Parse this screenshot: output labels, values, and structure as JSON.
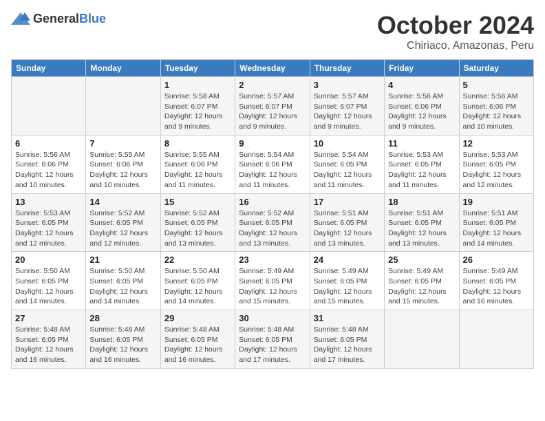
{
  "header": {
    "logo_general": "General",
    "logo_blue": "Blue",
    "month": "October 2024",
    "location": "Chiriaco, Amazonas, Peru"
  },
  "weekdays": [
    "Sunday",
    "Monday",
    "Tuesday",
    "Wednesday",
    "Thursday",
    "Friday",
    "Saturday"
  ],
  "weeks": [
    [
      {
        "day": "",
        "detail": ""
      },
      {
        "day": "",
        "detail": ""
      },
      {
        "day": "1",
        "detail": "Sunrise: 5:58 AM\nSunset: 6:07 PM\nDaylight: 12 hours and 9 minutes."
      },
      {
        "day": "2",
        "detail": "Sunrise: 5:57 AM\nSunset: 6:07 PM\nDaylight: 12 hours and 9 minutes."
      },
      {
        "day": "3",
        "detail": "Sunrise: 5:57 AM\nSunset: 6:07 PM\nDaylight: 12 hours and 9 minutes."
      },
      {
        "day": "4",
        "detail": "Sunrise: 5:56 AM\nSunset: 6:06 PM\nDaylight: 12 hours and 9 minutes."
      },
      {
        "day": "5",
        "detail": "Sunrise: 5:56 AM\nSunset: 6:06 PM\nDaylight: 12 hours and 10 minutes."
      }
    ],
    [
      {
        "day": "6",
        "detail": "Sunrise: 5:56 AM\nSunset: 6:06 PM\nDaylight: 12 hours and 10 minutes."
      },
      {
        "day": "7",
        "detail": "Sunrise: 5:55 AM\nSunset: 6:06 PM\nDaylight: 12 hours and 10 minutes."
      },
      {
        "day": "8",
        "detail": "Sunrise: 5:55 AM\nSunset: 6:06 PM\nDaylight: 12 hours and 11 minutes."
      },
      {
        "day": "9",
        "detail": "Sunrise: 5:54 AM\nSunset: 6:06 PM\nDaylight: 12 hours and 11 minutes."
      },
      {
        "day": "10",
        "detail": "Sunrise: 5:54 AM\nSunset: 6:05 PM\nDaylight: 12 hours and 11 minutes."
      },
      {
        "day": "11",
        "detail": "Sunrise: 5:53 AM\nSunset: 6:05 PM\nDaylight: 12 hours and 11 minutes."
      },
      {
        "day": "12",
        "detail": "Sunrise: 5:53 AM\nSunset: 6:05 PM\nDaylight: 12 hours and 12 minutes."
      }
    ],
    [
      {
        "day": "13",
        "detail": "Sunrise: 5:53 AM\nSunset: 6:05 PM\nDaylight: 12 hours and 12 minutes."
      },
      {
        "day": "14",
        "detail": "Sunrise: 5:52 AM\nSunset: 6:05 PM\nDaylight: 12 hours and 12 minutes."
      },
      {
        "day": "15",
        "detail": "Sunrise: 5:52 AM\nSunset: 6:05 PM\nDaylight: 12 hours and 13 minutes."
      },
      {
        "day": "16",
        "detail": "Sunrise: 5:52 AM\nSunset: 6:05 PM\nDaylight: 12 hours and 13 minutes."
      },
      {
        "day": "17",
        "detail": "Sunrise: 5:51 AM\nSunset: 6:05 PM\nDaylight: 12 hours and 13 minutes."
      },
      {
        "day": "18",
        "detail": "Sunrise: 5:51 AM\nSunset: 6:05 PM\nDaylight: 12 hours and 13 minutes."
      },
      {
        "day": "19",
        "detail": "Sunrise: 5:51 AM\nSunset: 6:05 PM\nDaylight: 12 hours and 14 minutes."
      }
    ],
    [
      {
        "day": "20",
        "detail": "Sunrise: 5:50 AM\nSunset: 6:05 PM\nDaylight: 12 hours and 14 minutes."
      },
      {
        "day": "21",
        "detail": "Sunrise: 5:50 AM\nSunset: 6:05 PM\nDaylight: 12 hours and 14 minutes."
      },
      {
        "day": "22",
        "detail": "Sunrise: 5:50 AM\nSunset: 6:05 PM\nDaylight: 12 hours and 14 minutes."
      },
      {
        "day": "23",
        "detail": "Sunrise: 5:49 AM\nSunset: 6:05 PM\nDaylight: 12 hours and 15 minutes."
      },
      {
        "day": "24",
        "detail": "Sunrise: 5:49 AM\nSunset: 6:05 PM\nDaylight: 12 hours and 15 minutes."
      },
      {
        "day": "25",
        "detail": "Sunrise: 5:49 AM\nSunset: 6:05 PM\nDaylight: 12 hours and 15 minutes."
      },
      {
        "day": "26",
        "detail": "Sunrise: 5:49 AM\nSunset: 6:05 PM\nDaylight: 12 hours and 16 minutes."
      }
    ],
    [
      {
        "day": "27",
        "detail": "Sunrise: 5:48 AM\nSunset: 6:05 PM\nDaylight: 12 hours and 16 minutes."
      },
      {
        "day": "28",
        "detail": "Sunrise: 5:48 AM\nSunset: 6:05 PM\nDaylight: 12 hours and 16 minutes."
      },
      {
        "day": "29",
        "detail": "Sunrise: 5:48 AM\nSunset: 6:05 PM\nDaylight: 12 hours and 16 minutes."
      },
      {
        "day": "30",
        "detail": "Sunrise: 5:48 AM\nSunset: 6:05 PM\nDaylight: 12 hours and 17 minutes."
      },
      {
        "day": "31",
        "detail": "Sunrise: 5:48 AM\nSunset: 6:05 PM\nDaylight: 12 hours and 17 minutes."
      },
      {
        "day": "",
        "detail": ""
      },
      {
        "day": "",
        "detail": ""
      }
    ]
  ]
}
